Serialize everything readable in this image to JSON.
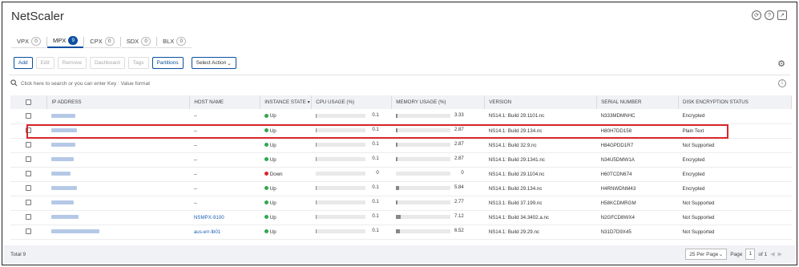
{
  "app": {
    "title": "NetScaler"
  },
  "header_icons": [
    "refresh-icon",
    "help-icon",
    "external-link-icon"
  ],
  "tabs": [
    {
      "label": "VPX",
      "count": "0",
      "active": false
    },
    {
      "label": "MPX",
      "count": "9",
      "active": true
    },
    {
      "label": "CPX",
      "count": "0",
      "active": false
    },
    {
      "label": "SDX",
      "count": "0",
      "active": false
    },
    {
      "label": "BLX",
      "count": "0",
      "active": false
    }
  ],
  "toolbar": {
    "add": "Add",
    "edit": "Edit",
    "remove": "Remove",
    "dashboard": "Dashboard",
    "tags": "Tags",
    "partitions": "Partitions",
    "select_action": "Select Action"
  },
  "search": {
    "placeholder": "Click here to search or you can enter Key : Value format"
  },
  "table": {
    "columns": [
      "IP ADDRESS",
      "HOST NAME",
      "INSTANCE STATE",
      "CPU USAGE (%)",
      "MEMORY USAGE (%)",
      "VERSION",
      "SERIAL NUMBER",
      "DISK ENCRYPTION STATUS"
    ],
    "rows": [
      {
        "host": "--",
        "state": "Up",
        "cpu": "0.1",
        "mem": "3.33",
        "version": "NS14.1: Build 29.1101.nc",
        "serial": "N333MDMNHC",
        "enc": "Encrypted"
      },
      {
        "host": "--",
        "state": "Up",
        "cpu": "0.1",
        "mem": "2.87",
        "version": "NS14.1: Build 29.134.nc",
        "serial": "H80H7DD158",
        "enc": "Plain Text"
      },
      {
        "host": "--",
        "state": "Up",
        "cpu": "0.1",
        "mem": "2.87",
        "version": "NS14.1: Build 32.9.nc",
        "serial": "H84GPDD1R7",
        "enc": "Not Supported"
      },
      {
        "host": "--",
        "state": "Up",
        "cpu": "0.1",
        "mem": "2.87",
        "version": "NS14.1: Build 29.1341.nc",
        "serial": "N34U5DMW1A",
        "enc": "Encrypted"
      },
      {
        "host": "--",
        "state": "Down",
        "cpu": "0",
        "mem": "0",
        "version": "NS14.1: Build 29.1104.nc",
        "serial": "H60TCDN674",
        "enc": "Encrypted"
      },
      {
        "host": "--",
        "state": "Up",
        "cpu": "0.1",
        "mem": "5.84",
        "version": "NS14.1: Build 29.134.nc",
        "serial": "H4RNWDNM43",
        "enc": "Encrypted"
      },
      {
        "host": "--",
        "state": "Up",
        "cpu": "0.1",
        "mem": "2.77",
        "version": "NS13.1: Build 37.199.nc",
        "serial": "H58KCDMRGM",
        "enc": "Not Supported"
      },
      {
        "host": "NSMPX-9100",
        "state": "Up",
        "cpu": "0.1",
        "mem": "7.12",
        "version": "NS14.1: Build 34.3402.a.nc",
        "serial": "N2GFCD8WX4",
        "enc": "Not Supported"
      },
      {
        "host": "aus-err-lb01",
        "state": "Up",
        "cpu": "0.1",
        "mem": "6.52",
        "version": "NS14.1: Build 29.29.nc",
        "serial": "N31D7D9X45",
        "enc": "Not Supported"
      }
    ]
  },
  "footer": {
    "total": "Total 9",
    "per_page": "25 Per Page",
    "page_label": "Page",
    "page": "1",
    "of": "of 1"
  },
  "colors": {
    "accent": "#0b4fa0",
    "up": "#2fa84f",
    "down": "#d9262b",
    "highlight": "#d9262b"
  }
}
